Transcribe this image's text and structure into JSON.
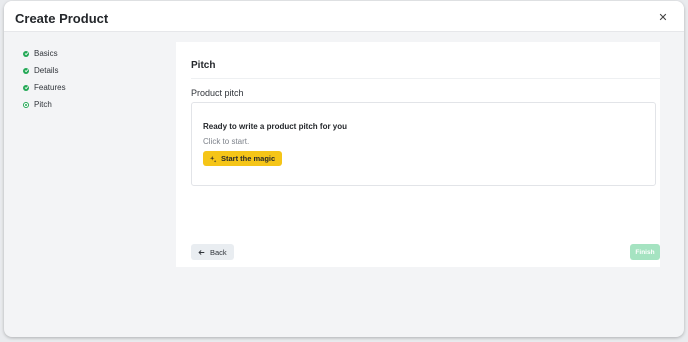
{
  "modal": {
    "title": "Create Product",
    "close_icon": "close-icon"
  },
  "steps": [
    {
      "label": "Basics",
      "status": "completed"
    },
    {
      "label": "Details",
      "status": "completed"
    },
    {
      "label": "Features",
      "status": "completed"
    },
    {
      "label": "Pitch",
      "status": "current"
    }
  ],
  "panel": {
    "title": "Pitch",
    "field_label": "Product pitch",
    "pitch_heading": "Ready to write a product pitch for you",
    "pitch_sub": "Click to start.",
    "magic_button": "Start the magic",
    "magic_icon": "sparkle-icon"
  },
  "footer": {
    "back_label": "Back",
    "back_icon": "arrow-left-icon",
    "finish_label": "Finish",
    "finish_enabled": false
  },
  "colors": {
    "accent_green": "#22a855",
    "magic_yellow": "#f5c518",
    "finish_disabled": "#a5e3c1"
  }
}
